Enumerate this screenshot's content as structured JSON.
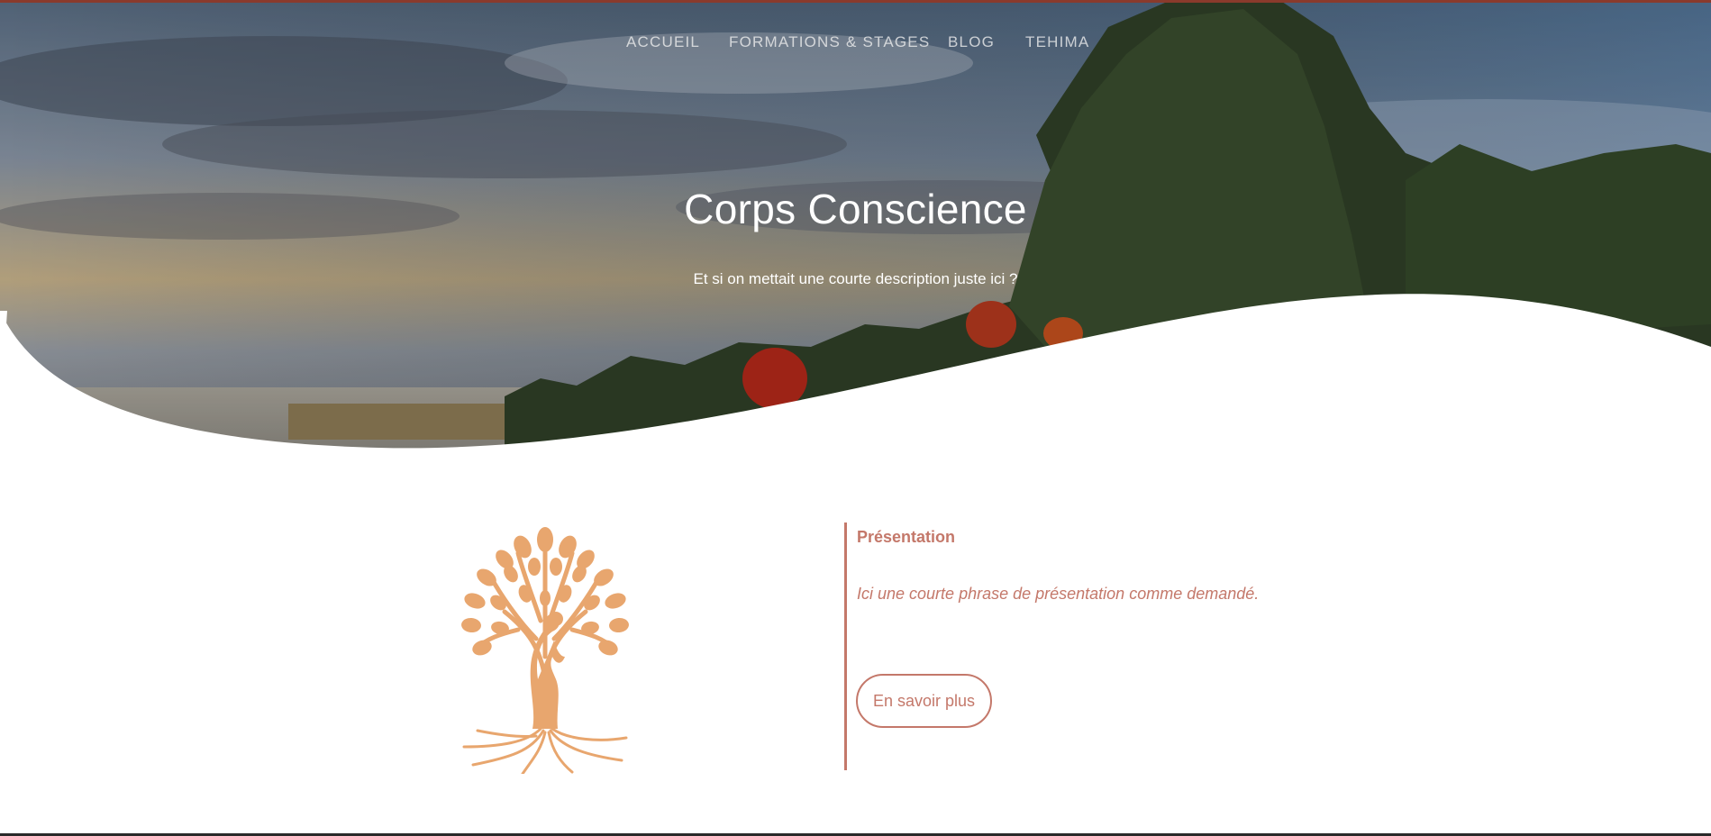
{
  "nav": {
    "items": [
      {
        "label": "ACCUEIL"
      },
      {
        "label": "FORMATIONS & STAGES"
      },
      {
        "label": "BLOG"
      },
      {
        "label": "TEHIMA"
      }
    ]
  },
  "hero": {
    "title": "Corps Conscience",
    "subtitle": "Et si on mettait une courte description juste ici ?"
  },
  "presentation": {
    "heading": "Présentation",
    "text": "Ici une courte phrase de présentation comme demandé.",
    "button_label": "En savoir plus"
  },
  "colors": {
    "accent": "#c4786a",
    "logo": "#e8a66e",
    "top_bar": "#8a3a2c"
  },
  "icons": {
    "logo": "tree-of-life-woman-icon"
  }
}
